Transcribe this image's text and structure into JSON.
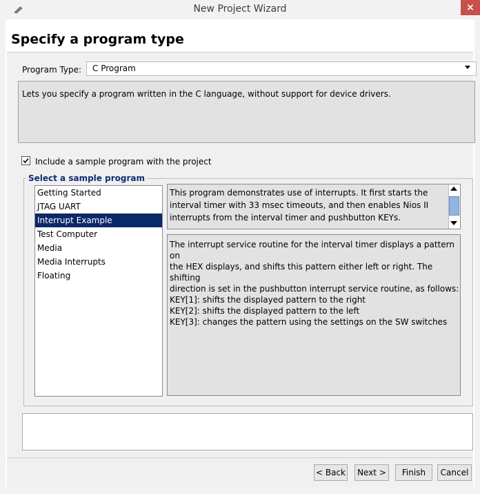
{
  "window": {
    "title": "New Project Wizard",
    "close_glyph": "×"
  },
  "page": {
    "title": "Specify a program type"
  },
  "program_type": {
    "label": "Program Type:",
    "value": "C Program",
    "description": "Lets you specify a program written in the C language, without support for device drivers."
  },
  "sample": {
    "include_label": "Include a sample program with the project",
    "include_checked": true,
    "group_title": "Select a sample program",
    "items": [
      "Getting Started",
      "JTAG UART",
      "Interrupt Example",
      "Test Computer",
      "Media",
      "Media Interrupts",
      "Floating"
    ],
    "selected_index": 2,
    "summary": "This program demonstrates use of interrupts. It first starts the interval timer with 33 msec timeouts, and then enables Nios II interrupts from the interval timer and pushbutton KEYs.",
    "details": [
      "The interrupt service routine for the interval timer displays a pattern on",
      "the HEX displays, and shifts this pattern either left or right. The shifting",
      "direction is set in the pushbutton interrupt service routine, as follows:",
      "KEY[1]: shifts the displayed pattern to the right",
      "KEY[2]: shifts the displayed pattern to the left",
      "KEY[3]: changes the pattern using the settings on the SW switches"
    ]
  },
  "buttons": {
    "back": "< Back",
    "next": "Next >",
    "finish": "Finish",
    "cancel": "Cancel"
  },
  "icons": {
    "app": "pencil-icon",
    "dropdown": "chevron-down-icon",
    "scroll_up": "scroll-up-icon",
    "scroll_down": "scroll-down-icon"
  },
  "colors": {
    "selection": "#0b2868",
    "group_title": "#0f2d6f",
    "close_button": "#c7504b"
  }
}
